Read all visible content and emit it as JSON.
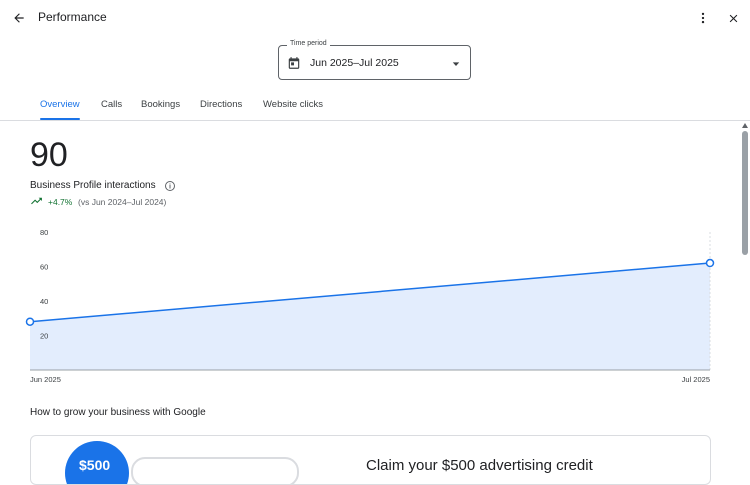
{
  "header": {
    "title": "Performance",
    "back_icon": "arrow-back-icon",
    "more_icon": "more-vertical-icon",
    "close_icon": "close-icon"
  },
  "time_period": {
    "label": "Time period",
    "value": "Jun 2025–Jul 2025",
    "icon": "calendar-icon"
  },
  "tabs": [
    {
      "label": "Overview",
      "active": true
    },
    {
      "label": "Calls",
      "active": false
    },
    {
      "label": "Bookings",
      "active": false
    },
    {
      "label": "Directions",
      "active": false
    },
    {
      "label": "Website clicks",
      "active": false
    }
  ],
  "summary": {
    "total": "90",
    "label": "Business Profile interactions",
    "trend": "+4.7%",
    "compare": "(vs Jun 2024–Jul 2024)",
    "trend_color": "#137333"
  },
  "chart_data": {
    "type": "area",
    "categories": [
      "Jun 2025",
      "Jul 2025"
    ],
    "values": [
      28,
      62
    ],
    "ylim": [
      0,
      80
    ],
    "yticks": [
      20,
      40,
      60,
      80
    ],
    "grid": false,
    "line_color": "#1a73e8",
    "fill_color": "#e3edfd"
  },
  "grow": {
    "title": "How to grow your business with Google",
    "promo_badge": "$500",
    "promo_headline": "Claim your $500 advertising credit"
  },
  "colors": {
    "accent": "#1a73e8"
  }
}
